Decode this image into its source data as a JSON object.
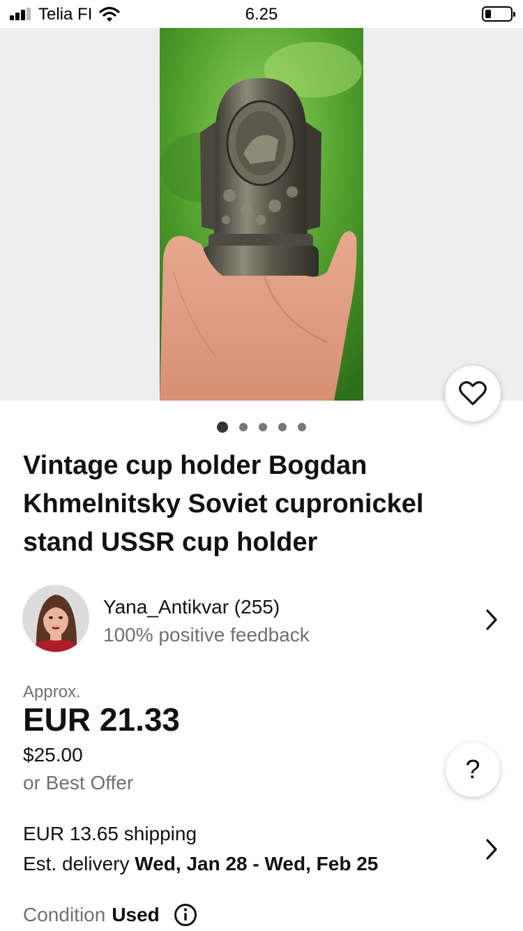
{
  "status_bar": {
    "carrier": "Telia FI",
    "time": "6.25"
  },
  "gallery": {
    "image_count": 5,
    "active_index": 0
  },
  "listing": {
    "title": "Vintage cup holder Bogdan Khmelnitsky Soviet cupronickel stand USSR cup holder"
  },
  "seller": {
    "name": "Yana_Antikvar (255)",
    "feedback": "100% positive feedback"
  },
  "price": {
    "approx_label": "Approx.",
    "converted": "EUR 21.33",
    "original": "$25.00",
    "best_offer": "or Best Offer"
  },
  "shipping": {
    "cost": "EUR 13.65 shipping",
    "delivery_label": "Est. delivery",
    "delivery_dates": "Wed, Jan 28 - Wed, Feb 25"
  },
  "condition": {
    "label": "Condition",
    "value": "Used"
  },
  "buttons": {
    "help": "?"
  },
  "icons": [
    "signal-icon",
    "wifi-icon",
    "battery-icon",
    "heart-icon",
    "chevron-right-icon",
    "help-icon",
    "info-icon"
  ]
}
